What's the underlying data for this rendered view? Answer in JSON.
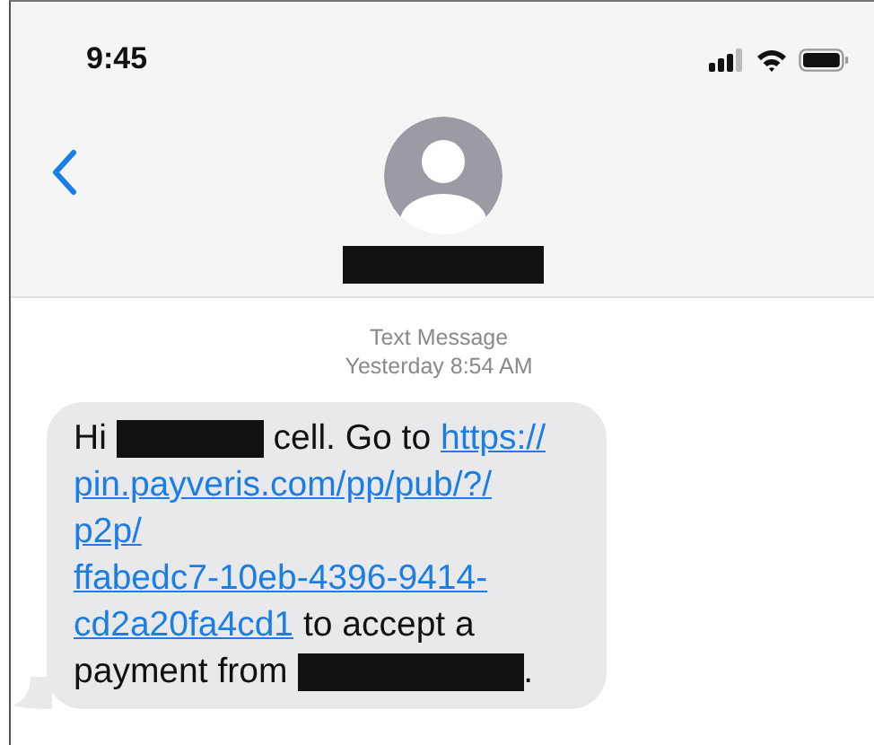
{
  "status_bar": {
    "time": "9:45"
  },
  "header": {
    "contact_name": {
      "kind": "redacted"
    }
  },
  "thread": {
    "service": "Text Message",
    "timestamp": "Yesterday 8:54 AM"
  },
  "message": {
    "segments": [
      {
        "kind": "text",
        "text": "Hi"
      },
      {
        "kind": "redacted"
      },
      {
        "kind": "text",
        "text": "cell. Go to"
      },
      {
        "kind": "link",
        "text": "https://"
      },
      {
        "kind": "break"
      },
      {
        "kind": "link",
        "text": "pin.payveris.com/pp/pub/?/"
      },
      {
        "kind": "break"
      },
      {
        "kind": "link",
        "text": "p2p/"
      },
      {
        "kind": "break"
      },
      {
        "kind": "link",
        "text": "ffabedc7-10eb-4396-9414-"
      },
      {
        "kind": "break"
      },
      {
        "kind": "link",
        "text": "cd2a20fa4cd1"
      },
      {
        "kind": "text",
        "text": "to accept a"
      },
      {
        "kind": "break"
      },
      {
        "kind": "text",
        "text": "payment from"
      },
      {
        "kind": "redacted"
      },
      {
        "kind": "text",
        "text": "."
      }
    ]
  }
}
